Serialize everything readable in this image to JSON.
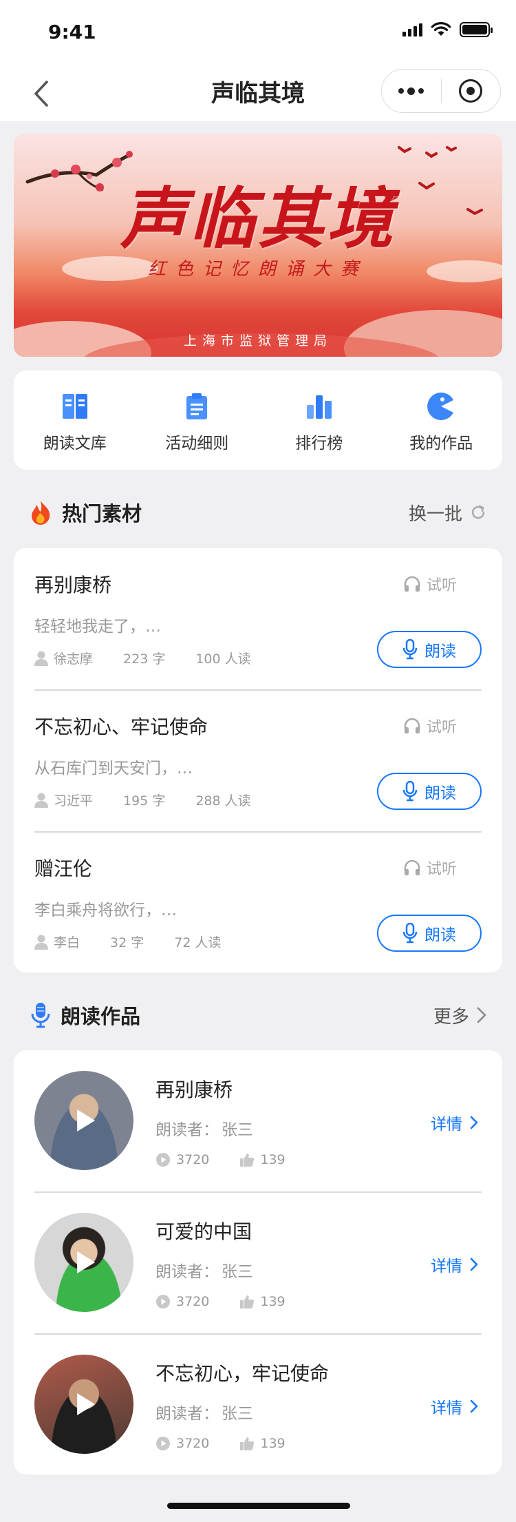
{
  "status": {
    "time": "9:41"
  },
  "nav": {
    "title": "声临其境"
  },
  "banner": {
    "title": "声临其境",
    "subtitle": "红色记忆朗诵大赛",
    "organizer": "上海市监狱管理局"
  },
  "quick_menu": [
    {
      "label": "朗读文库",
      "icon": "book-icon"
    },
    {
      "label": "活动细则",
      "icon": "clipboard-icon"
    },
    {
      "label": "排行榜",
      "icon": "bar-chart-icon"
    },
    {
      "label": "我的作品",
      "icon": "pie-icon"
    }
  ],
  "hot_materials": {
    "title": "热门素材",
    "refresh_label": "换一批",
    "listen_label": "试听",
    "read_label": "朗读",
    "items": [
      {
        "title": "再别康桥",
        "preview": "轻轻地我走了，…",
        "author": "徐志摩",
        "chars": "223 字",
        "readers": "100 人读"
      },
      {
        "title": "不忘初心、牢记使命",
        "preview": "从石库门到天安门，…",
        "author": "习近平",
        "chars": "195 字",
        "readers": "288 人读"
      },
      {
        "title": "赠汪伦",
        "preview": "李白乘舟将欲行，…",
        "author": "李白",
        "chars": "32 字",
        "readers": "72 人读"
      }
    ]
  },
  "works": {
    "title": "朗读作品",
    "more_label": "更多",
    "reader_prefix": "朗读者：",
    "detail_label": "详情",
    "items": [
      {
        "title": "再别康桥",
        "reader": "张三",
        "plays": "3720",
        "likes": "139"
      },
      {
        "title": "可爱的中国",
        "reader": "张三",
        "plays": "3720",
        "likes": "139"
      },
      {
        "title": "不忘初心，牢记使命",
        "reader": "张三",
        "plays": "3720",
        "likes": "139"
      }
    ]
  },
  "colors": {
    "accent": "#1677ff",
    "banner_red": "#c8151b",
    "page_bg": "#f0f0f2"
  }
}
